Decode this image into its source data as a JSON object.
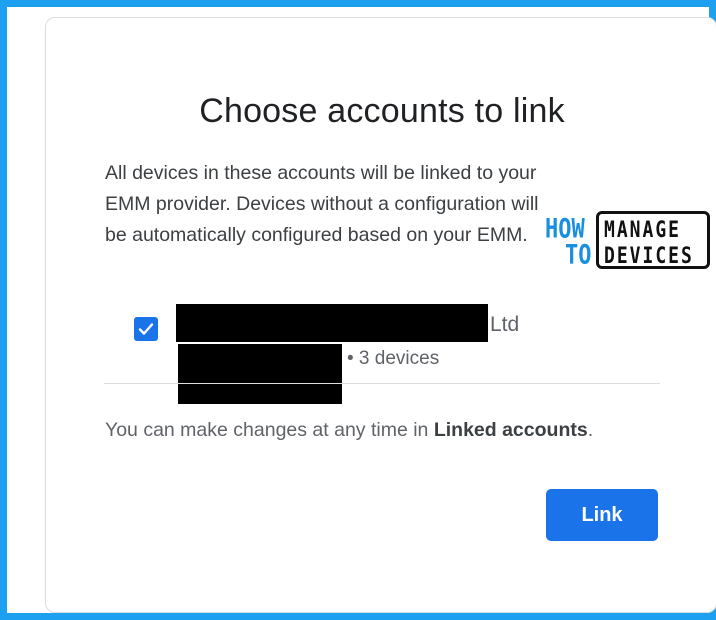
{
  "dialog": {
    "title": "Choose accounts to link",
    "description": "All devices in these accounts will be linked to your EMM provider. Devices without a configuration will be automatically configured based on your EMM.",
    "account": {
      "checked": true,
      "name_visible_suffix": "Ltd",
      "device_count": "• 3 devices"
    },
    "footer": {
      "text_before": "You can make changes at any time in ",
      "link_label": "Linked accounts",
      "text_after": "."
    },
    "link_button_label": "Link"
  },
  "watermark": {
    "how": "HOW",
    "to": "TO",
    "manage": "MANAGE",
    "devices": "DEVICES"
  },
  "colors": {
    "frame_border": "#1ea0f0",
    "primary": "#1a73e8",
    "text_primary": "#202124",
    "text_secondary": "#5f6368"
  }
}
